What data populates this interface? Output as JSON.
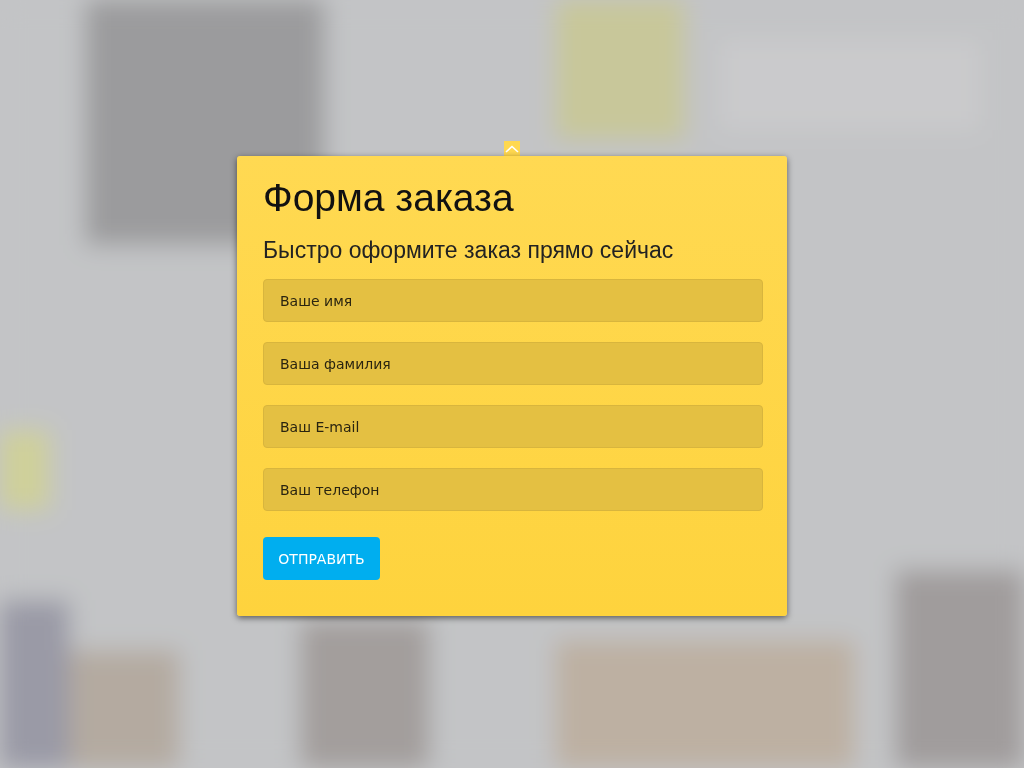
{
  "form": {
    "title": "Форма заказа",
    "subtitle": "Быстро оформите заказ прямо сейчас",
    "fields": [
      {
        "placeholder": "Ваше имя"
      },
      {
        "placeholder": "Ваша фамилия"
      },
      {
        "placeholder": "Ваш E-mail"
      },
      {
        "placeholder": "Ваш телефон"
      }
    ],
    "submit": "ОТПРАВИТЬ"
  }
}
